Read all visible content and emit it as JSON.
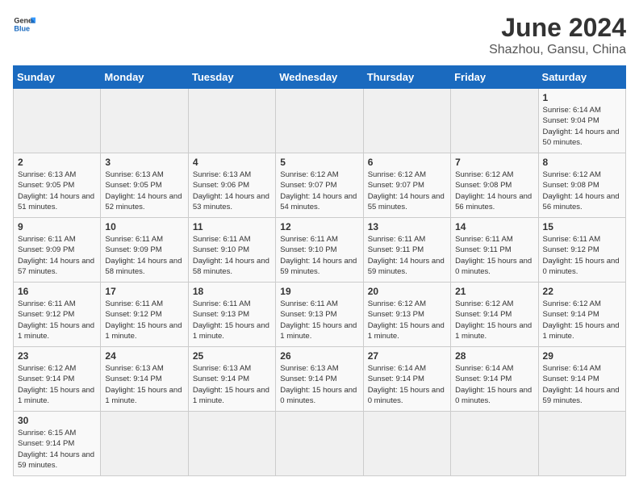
{
  "header": {
    "logo_general": "General",
    "logo_blue": "Blue",
    "month": "June 2024",
    "location": "Shazhou, Gansu, China"
  },
  "days_of_week": [
    "Sunday",
    "Monday",
    "Tuesday",
    "Wednesday",
    "Thursday",
    "Friday",
    "Saturday"
  ],
  "weeks": [
    [
      {
        "day": "",
        "info": ""
      },
      {
        "day": "",
        "info": ""
      },
      {
        "day": "",
        "info": ""
      },
      {
        "day": "",
        "info": ""
      },
      {
        "day": "",
        "info": ""
      },
      {
        "day": "",
        "info": ""
      },
      {
        "day": "1",
        "info": "Sunrise: 6:14 AM\nSunset: 9:04 PM\nDaylight: 14 hours and 50 minutes."
      }
    ],
    [
      {
        "day": "2",
        "info": "Sunrise: 6:13 AM\nSunset: 9:05 PM\nDaylight: 14 hours and 51 minutes."
      },
      {
        "day": "3",
        "info": "Sunrise: 6:13 AM\nSunset: 9:05 PM\nDaylight: 14 hours and 52 minutes."
      },
      {
        "day": "4",
        "info": "Sunrise: 6:13 AM\nSunset: 9:06 PM\nDaylight: 14 hours and 53 minutes."
      },
      {
        "day": "5",
        "info": "Sunrise: 6:12 AM\nSunset: 9:07 PM\nDaylight: 14 hours and 54 minutes."
      },
      {
        "day": "6",
        "info": "Sunrise: 6:12 AM\nSunset: 9:07 PM\nDaylight: 14 hours and 55 minutes."
      },
      {
        "day": "7",
        "info": "Sunrise: 6:12 AM\nSunset: 9:08 PM\nDaylight: 14 hours and 56 minutes."
      },
      {
        "day": "8",
        "info": "Sunrise: 6:12 AM\nSunset: 9:08 PM\nDaylight: 14 hours and 56 minutes."
      }
    ],
    [
      {
        "day": "9",
        "info": "Sunrise: 6:11 AM\nSunset: 9:09 PM\nDaylight: 14 hours and 57 minutes."
      },
      {
        "day": "10",
        "info": "Sunrise: 6:11 AM\nSunset: 9:09 PM\nDaylight: 14 hours and 58 minutes."
      },
      {
        "day": "11",
        "info": "Sunrise: 6:11 AM\nSunset: 9:10 PM\nDaylight: 14 hours and 58 minutes."
      },
      {
        "day": "12",
        "info": "Sunrise: 6:11 AM\nSunset: 9:10 PM\nDaylight: 14 hours and 59 minutes."
      },
      {
        "day": "13",
        "info": "Sunrise: 6:11 AM\nSunset: 9:11 PM\nDaylight: 14 hours and 59 minutes."
      },
      {
        "day": "14",
        "info": "Sunrise: 6:11 AM\nSunset: 9:11 PM\nDaylight: 15 hours and 0 minutes."
      },
      {
        "day": "15",
        "info": "Sunrise: 6:11 AM\nSunset: 9:12 PM\nDaylight: 15 hours and 0 minutes."
      }
    ],
    [
      {
        "day": "16",
        "info": "Sunrise: 6:11 AM\nSunset: 9:12 PM\nDaylight: 15 hours and 1 minute."
      },
      {
        "day": "17",
        "info": "Sunrise: 6:11 AM\nSunset: 9:12 PM\nDaylight: 15 hours and 1 minute."
      },
      {
        "day": "18",
        "info": "Sunrise: 6:11 AM\nSunset: 9:13 PM\nDaylight: 15 hours and 1 minute."
      },
      {
        "day": "19",
        "info": "Sunrise: 6:11 AM\nSunset: 9:13 PM\nDaylight: 15 hours and 1 minute."
      },
      {
        "day": "20",
        "info": "Sunrise: 6:12 AM\nSunset: 9:13 PM\nDaylight: 15 hours and 1 minute."
      },
      {
        "day": "21",
        "info": "Sunrise: 6:12 AM\nSunset: 9:14 PM\nDaylight: 15 hours and 1 minute."
      },
      {
        "day": "22",
        "info": "Sunrise: 6:12 AM\nSunset: 9:14 PM\nDaylight: 15 hours and 1 minute."
      }
    ],
    [
      {
        "day": "23",
        "info": "Sunrise: 6:12 AM\nSunset: 9:14 PM\nDaylight: 15 hours and 1 minute."
      },
      {
        "day": "24",
        "info": "Sunrise: 6:13 AM\nSunset: 9:14 PM\nDaylight: 15 hours and 1 minute."
      },
      {
        "day": "25",
        "info": "Sunrise: 6:13 AM\nSunset: 9:14 PM\nDaylight: 15 hours and 1 minute."
      },
      {
        "day": "26",
        "info": "Sunrise: 6:13 AM\nSunset: 9:14 PM\nDaylight: 15 hours and 0 minutes."
      },
      {
        "day": "27",
        "info": "Sunrise: 6:14 AM\nSunset: 9:14 PM\nDaylight: 15 hours and 0 minutes."
      },
      {
        "day": "28",
        "info": "Sunrise: 6:14 AM\nSunset: 9:14 PM\nDaylight: 15 hours and 0 minutes."
      },
      {
        "day": "29",
        "info": "Sunrise: 6:14 AM\nSunset: 9:14 PM\nDaylight: 14 hours and 59 minutes."
      }
    ],
    [
      {
        "day": "30",
        "info": "Sunrise: 6:15 AM\nSunset: 9:14 PM\nDaylight: 14 hours and 59 minutes."
      },
      {
        "day": "",
        "info": ""
      },
      {
        "day": "",
        "info": ""
      },
      {
        "day": "",
        "info": ""
      },
      {
        "day": "",
        "info": ""
      },
      {
        "day": "",
        "info": ""
      },
      {
        "day": "",
        "info": ""
      }
    ]
  ]
}
